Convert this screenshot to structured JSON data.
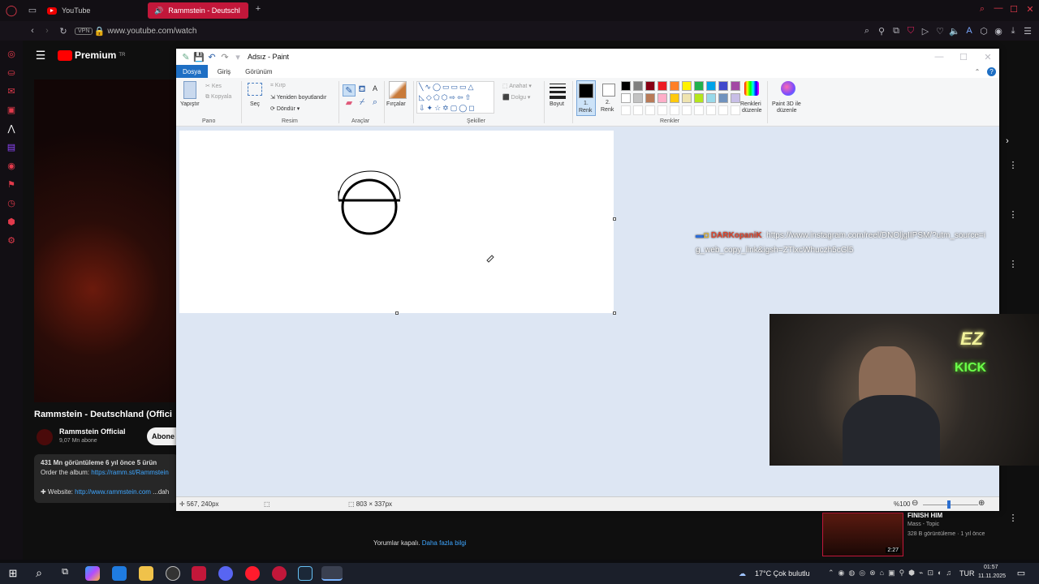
{
  "browser": {
    "tabs": [
      {
        "label": "YouTube"
      },
      {
        "label": "Rammstein - Deutschl"
      }
    ],
    "vpn_badge": "VPN",
    "url": "www.youtube.com/watch"
  },
  "youtube": {
    "logo": "Premium",
    "logo_sup": "TR",
    "video_title": "Rammstein - Deutschland (Offici",
    "channel_name": "Rammstein Official",
    "subscribers": "9,07 Mn abone",
    "subscribe_label": "Abone",
    "views_line": "431 Mn görüntüleme  6 yıl önce  5 ürün",
    "order_text": "Order the album: ",
    "order_link": "https://ramm.st/Rammstein",
    "website_text": "✚ Website: ",
    "website_link": "http://www.rammstein.com",
    "website_more": " ...dah",
    "comments_off": "Yorumlar kapalı.",
    "more_info": "Daha fazla bilgi",
    "chat_user": "DARKopaniK",
    "chat_message": ": https://www.instagram.com/reel/DNOljgIIPSM/?utm_source=ig_web_copy_link&igsh=ZTlxcWhuczh5cGl5",
    "side_title": "FINISH HIM",
    "side_channel": "Mass - Topic",
    "side_meta": "328 B görüntüleme · 1 yıl önce",
    "side_duration": "2:27"
  },
  "paint": {
    "title": "Adsız - Paint",
    "tabs": [
      "Dosya",
      "Giriş",
      "Görünüm"
    ],
    "clipboard": {
      "paste": "Yapıştır",
      "cut": "Kes",
      "copy": "Kopyala",
      "group": "Pano"
    },
    "image": {
      "select": "Seç",
      "crop": "Kırp",
      "resize": "Yeniden boyutlandır",
      "rotate": "Döndür ▾",
      "group": "Resim"
    },
    "tools": {
      "group": "Araçlar"
    },
    "brushes": {
      "label": "Fırçalar"
    },
    "shapes": {
      "outline": "Anahat ▾",
      "fill": "Dolgu ▾",
      "group": "Şekiller"
    },
    "size": {
      "label": "Boyut"
    },
    "color1": {
      "label1": "1.",
      "label2": "Renk"
    },
    "color2": {
      "label1": "2.",
      "label2": "Renk"
    },
    "colors_group": "Renkler",
    "edit_colors": {
      "l1": "Renkleri",
      "l2": "düzenle"
    },
    "paint3d": {
      "l1": "Paint 3D ile",
      "l2": "düzenle"
    },
    "palette_row1": [
      "#000000",
      "#7f7f7f",
      "#880015",
      "#ed1c24",
      "#ff7f27",
      "#fff200",
      "#22b14c",
      "#00a2e8",
      "#3f48cc",
      "#a349a4"
    ],
    "palette_row2": [
      "#ffffff",
      "#c3c3c3",
      "#b97a57",
      "#ffaec9",
      "#ffc90e",
      "#efe4b0",
      "#b5e61d",
      "#99d9ea",
      "#7092be",
      "#c8bfe7"
    ],
    "status": {
      "cursor": "567, 240px",
      "dimensions": "803 × 337px",
      "zoom": "%100"
    }
  },
  "webcam": {
    "sign_top": "EZ",
    "sign_bottom": "KICK"
  },
  "taskbar": {
    "weather": "17°C  Çok bulutlu",
    "lang": "TUR",
    "time": "01:57",
    "date": "11.11.2025"
  }
}
